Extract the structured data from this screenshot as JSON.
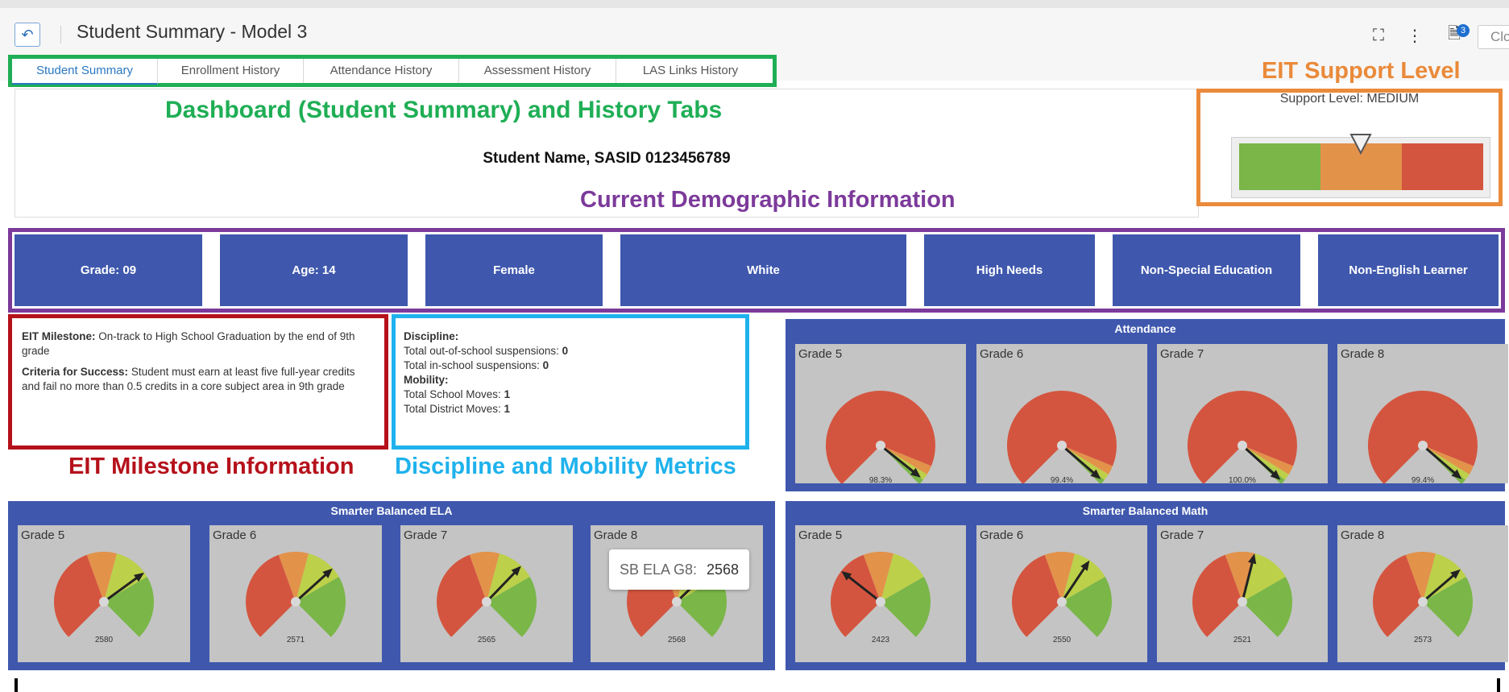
{
  "window": {
    "title": "Student Summary - Model 3",
    "notification_count": "3",
    "close_label": "Clo"
  },
  "tabs": [
    "Student Summary",
    "Enrollment History",
    "Attendance History",
    "Assessment History",
    "LAS Links History"
  ],
  "annotations": {
    "tabs": "Dashboard (Student Summary) and History Tabs",
    "support": "EIT Support Level",
    "demographics": "Current Demographic Information",
    "milestone": "EIT Milestone Information",
    "discipline": "Discipline and Mobility Metrics"
  },
  "support": {
    "label": "Support Level: MEDIUM",
    "level": "MEDIUM",
    "colors": [
      "#7ab648",
      "#e3924a",
      "#d4553f"
    ]
  },
  "student": {
    "name_line": "Student Name, SASID 0123456789"
  },
  "demographics": [
    "Grade: 09",
    "Age: 14",
    "Female",
    "White",
    "High Needs",
    "Non-Special Education",
    "Non-English Learner"
  ],
  "milestone": {
    "label": "EIT Milestone:",
    "text": "On-track to High School Graduation by the end of 9th grade",
    "criteria_label": "Criteria for Success:",
    "criteria_text": "Student must earn at least five full-year credits and fail no more than 0.5 credits in a core subject area in 9th grade"
  },
  "discipline": {
    "discipline_label": "Discipline:",
    "oos_label": "Total out-of-school suspensions:",
    "oos_value": "0",
    "ins_label": "Total in-school suspensions:",
    "ins_value": "0",
    "mobility_label": "Mobility:",
    "school_moves_label": "Total School Moves:",
    "school_moves_value": "1",
    "district_moves_label": "Total District Moves:",
    "district_moves_value": "1"
  },
  "attendance": {
    "title": "Attendance",
    "cards": [
      {
        "grade": "Grade 5",
        "value": "98.3%",
        "pct": 98.3
      },
      {
        "grade": "Grade 6",
        "value": "99.4%",
        "pct": 99.4
      },
      {
        "grade": "Grade 7",
        "value": "100.0%",
        "pct": 100.0
      },
      {
        "grade": "Grade 8",
        "value": "99.4%",
        "pct": 99.4
      }
    ]
  },
  "ela": {
    "title": "Smarter Balanced ELA",
    "cards": [
      {
        "grade": "Grade 5",
        "value": "2580"
      },
      {
        "grade": "Grade 6",
        "value": "2571"
      },
      {
        "grade": "Grade 7",
        "value": "2565"
      },
      {
        "grade": "Grade 8",
        "value": "2568"
      }
    ]
  },
  "math": {
    "title": "Smarter Balanced Math",
    "cards": [
      {
        "grade": "Grade 5",
        "value": "2423"
      },
      {
        "grade": "Grade 6",
        "value": "2550"
      },
      {
        "grade": "Grade 7",
        "value": "2521"
      },
      {
        "grade": "Grade 8",
        "value": "2573"
      }
    ]
  },
  "tooltip": {
    "label": "SB ELA G8:",
    "value": "2568"
  }
}
